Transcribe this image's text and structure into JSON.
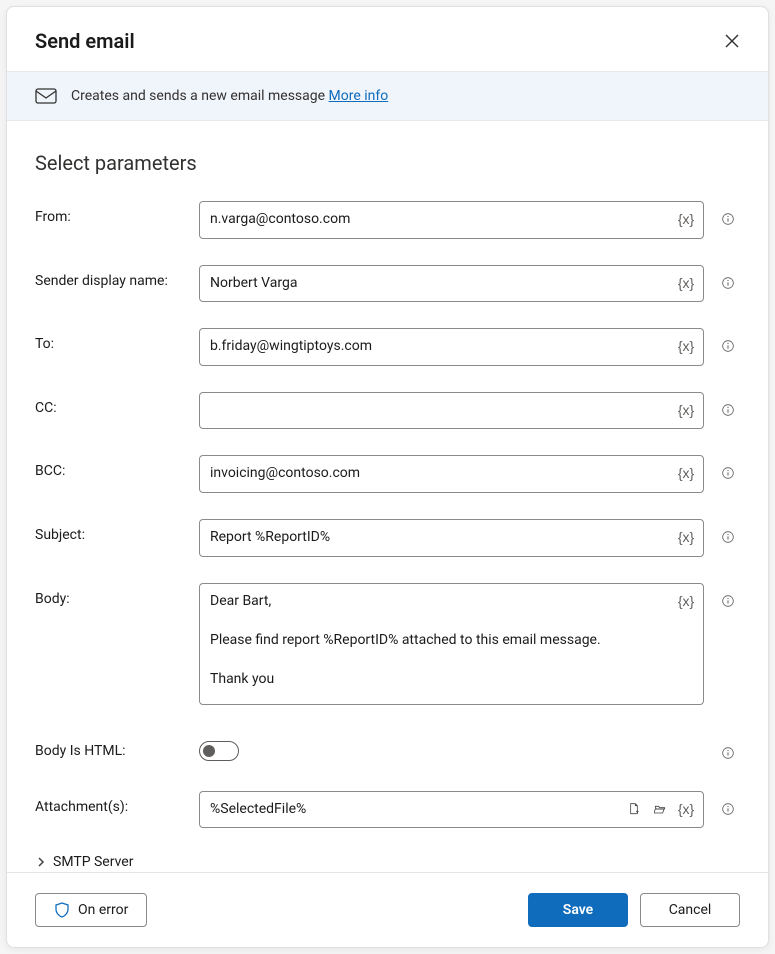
{
  "dialog": {
    "title": "Send email"
  },
  "banner": {
    "text": "Creates and sends a new email message ",
    "link_label": "More info"
  },
  "section": {
    "title": "Select parameters"
  },
  "fields": {
    "from": {
      "label": "From:",
      "value": "n.varga@contoso.com"
    },
    "sender": {
      "label": "Sender display name:",
      "value": "Norbert Varga"
    },
    "to": {
      "label": "To:",
      "value": "b.friday@wingtiptoys.com"
    },
    "cc": {
      "label": "CC:",
      "value": ""
    },
    "bcc": {
      "label": "BCC:",
      "value": "invoicing@contoso.com"
    },
    "subject": {
      "label": "Subject:",
      "value": "Report %ReportID%"
    },
    "body": {
      "label": "Body:",
      "value": "Dear Bart,\n\nPlease find report %ReportID% attached to this email message.\n\nThank you"
    },
    "body_html": {
      "label": "Body Is HTML:",
      "value": false
    },
    "attach": {
      "label": "Attachment(s):",
      "value": "%SelectedFile%"
    }
  },
  "expander": {
    "smtp_label": "SMTP Server"
  },
  "footer": {
    "on_error": "On error",
    "save": "Save",
    "cancel": "Cancel"
  },
  "icons": {
    "variable_token": "{x}"
  }
}
